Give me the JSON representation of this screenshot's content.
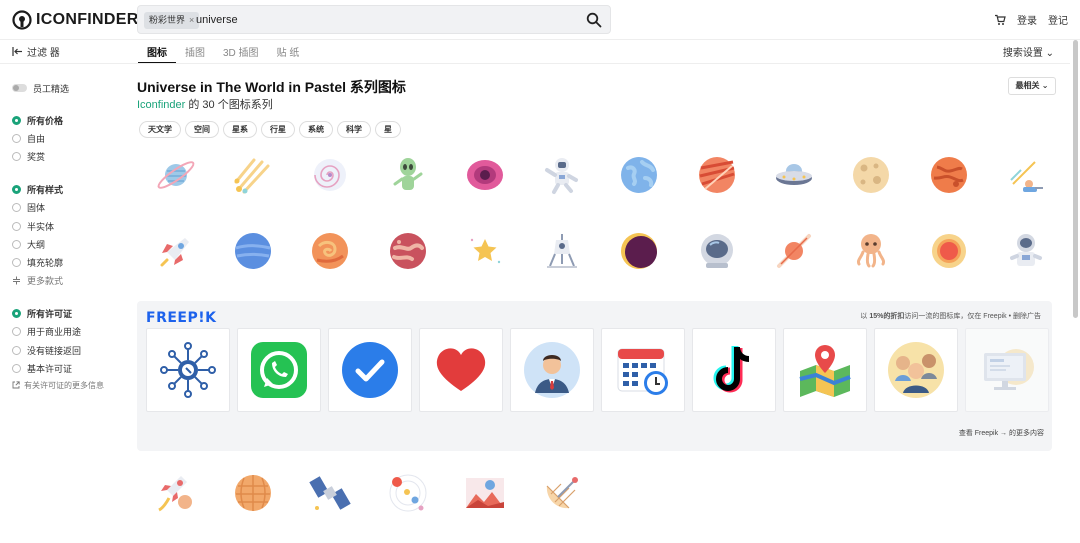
{
  "header": {
    "logo_text": "ICONFINDER",
    "search_chip": "粉彩世界",
    "search_chip_close": "×",
    "search_value": "universe",
    "cart_icon": "cart-icon",
    "login": "登录",
    "register": "登记"
  },
  "filter_toggle": "过滤 器",
  "tabs": [
    {
      "label": "图标",
      "active": true
    },
    {
      "label": "插图",
      "active": false
    },
    {
      "label": "3D 插图",
      "active": false
    },
    {
      "label": "贴 纸",
      "active": false
    }
  ],
  "search_settings": "搜索设置",
  "sidebar": {
    "staff_pick": "员工精选",
    "price": {
      "head": "所有价格",
      "options": [
        "自由",
        "奖赏"
      ]
    },
    "style": {
      "head": "所有样式",
      "options": [
        "固体",
        "半实体",
        "大纲",
        "填充轮廓"
      ],
      "more": "更多款式"
    },
    "license": {
      "head": "所有许可证",
      "options": [
        "用于商业用途",
        "没有链接返回",
        "基本许可证"
      ],
      "more": "有关许可证的更多信息"
    }
  },
  "main": {
    "title": "Universe in The World in Pastel 系列图标",
    "subtitle_brand": "Iconfinder",
    "subtitle_rest": " 的 30 个图标系列",
    "sort": "最相关",
    "tags": [
      "天文学",
      "空间",
      "星系",
      "行星",
      "系统",
      "科学",
      "星"
    ]
  },
  "icons_row1": [
    "saturn-icon",
    "shooting-stars-icon",
    "galaxy-icon",
    "alien-icon",
    "black-hole-icon",
    "astronaut-icon",
    "earth-icon",
    "jupiter-icon",
    "ufo-icon",
    "moon-icon",
    "mars-icon",
    "stargazing-icon"
  ],
  "icons_row2": [
    "rocket-icon",
    "neptune-icon",
    "swirl-planet-icon",
    "venus-icon",
    "star-icon",
    "lunar-lander-icon",
    "eclipse-icon",
    "astronaut-helmet-icon",
    "comet-planet-icon",
    "space-octopus-icon",
    "sun-icon",
    "robot-astronaut-icon"
  ],
  "icons_row3": [
    "rocket-launch-icon",
    "cratered-planet-icon",
    "satellite-icon",
    "solar-system-icon",
    "planet-landscape-icon",
    "satellite-dish-icon"
  ],
  "ad": {
    "logo": "FREEP!K",
    "note_a": "以",
    "note_pct": "15%",
    "note_b": "的折扣",
    "note_c": "访问一流的图标库，仅在 Freepik • 删除广告",
    "more": "查看 Freepik → 的更多内容",
    "cards": [
      "network-icon",
      "whatsapp-icon",
      "checkmark-icon",
      "heart-icon",
      "businessman-icon",
      "calendar-icon",
      "tiktok-icon",
      "map-pin-icon",
      "team-icon",
      "monitor-icon"
    ]
  },
  "colors": {
    "accent": "#1aa37a",
    "freepik_blue": "#1d62ec"
  }
}
